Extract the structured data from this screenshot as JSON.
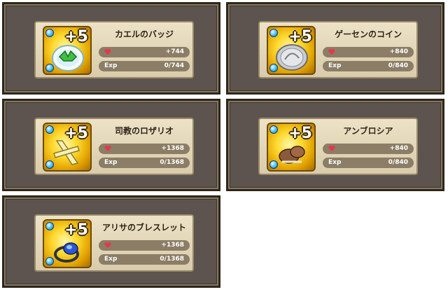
{
  "cards": [
    {
      "name": "カエルのバッジ",
      "plus": "+5",
      "hp": "+744",
      "exp_label": "Exp",
      "exp": "0/744",
      "item_icon": "frog-badge"
    },
    {
      "name": "ゲーセンのコイン",
      "plus": "+5",
      "hp": "+840",
      "exp_label": "Exp",
      "exp": "0/840",
      "item_icon": "arcade-coin"
    },
    {
      "name": "司教のロザリオ",
      "plus": "+5",
      "hp": "+1368",
      "exp_label": "Exp",
      "exp": "0/1368",
      "item_icon": "bishop-rosary"
    },
    {
      "name": "アンブロシア",
      "plus": "+5",
      "hp": "+840",
      "exp_label": "Exp",
      "exp": "0/840",
      "item_icon": "ambrosia"
    },
    {
      "name": "アリサのブレスレット",
      "plus": "+5",
      "hp": "+1368",
      "exp_label": "Exp",
      "exp": "0/1368",
      "item_icon": "arisa-bracelet"
    }
  ],
  "colors": {
    "panel": "#5e544f",
    "card": "#ede2c6",
    "bar": "#8b7d66",
    "heart": "#e8364a",
    "icon_gold": "#ffd92e"
  }
}
